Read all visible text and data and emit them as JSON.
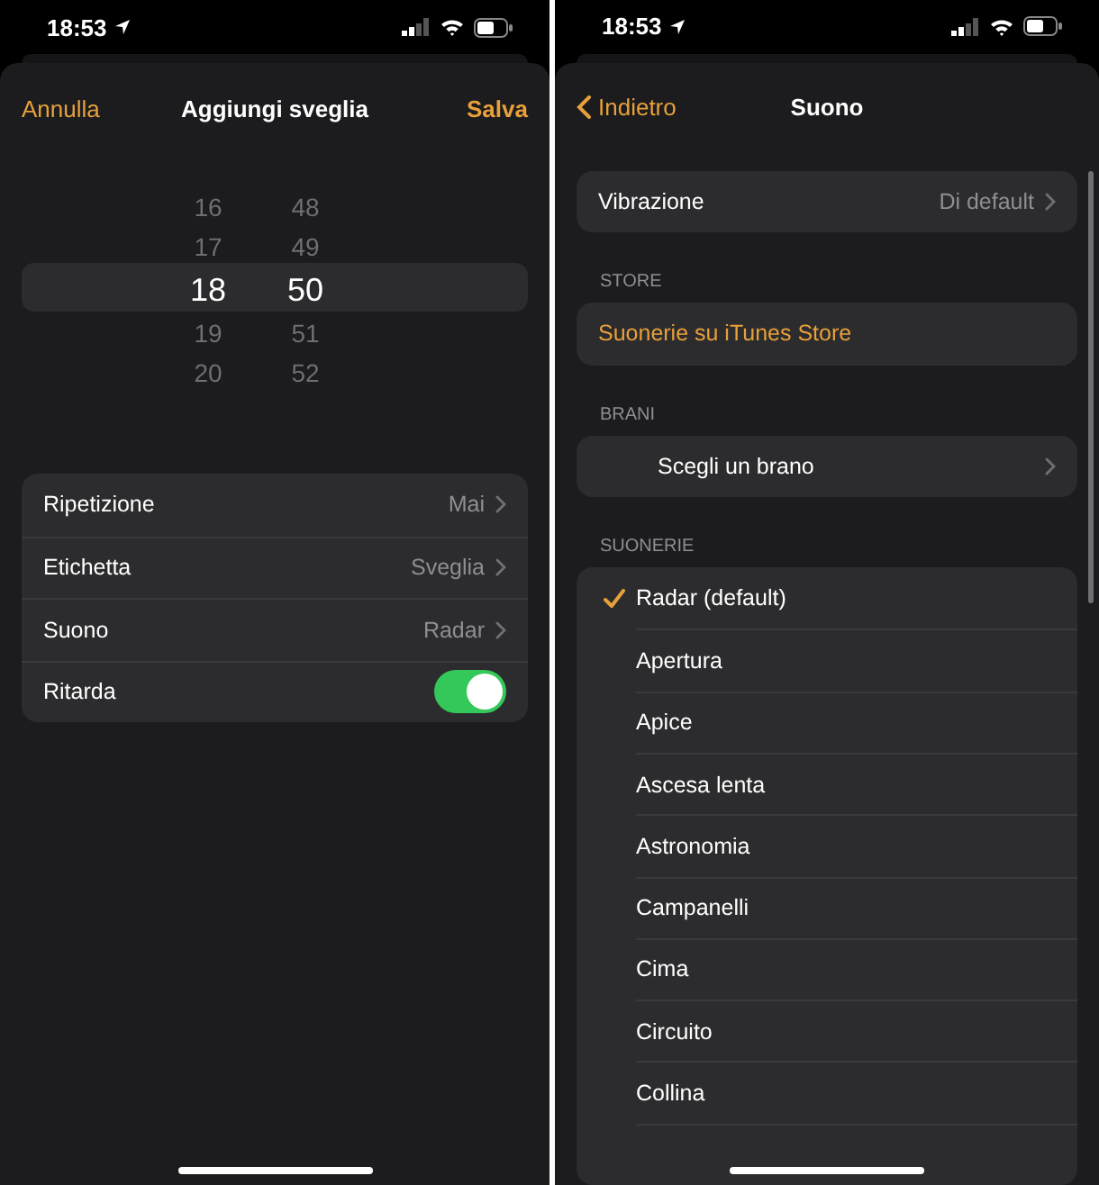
{
  "left_screen": {
    "status_bar": {
      "time": "18:53"
    },
    "nav": {
      "cancel": "Annulla",
      "title": "Aggiungi sveglia",
      "save": "Salva"
    },
    "picker": {
      "hours": [
        {
          "value": "16",
          "selected": false
        },
        {
          "value": "17",
          "selected": false
        },
        {
          "value": "18",
          "selected": true
        },
        {
          "value": "19",
          "selected": false
        },
        {
          "value": "20",
          "selected": false
        }
      ],
      "minutes": [
        {
          "value": "48",
          "selected": false
        },
        {
          "value": "49",
          "selected": false
        },
        {
          "value": "50",
          "selected": true
        },
        {
          "value": "51",
          "selected": false
        },
        {
          "value": "52",
          "selected": false
        }
      ]
    },
    "settings": [
      {
        "kind": "link",
        "label": "Ripetizione",
        "value": "Mai"
      },
      {
        "kind": "link",
        "label": "Etichetta",
        "value": "Sveglia"
      },
      {
        "kind": "link",
        "label": "Suono",
        "value": "Radar"
      },
      {
        "kind": "toggle",
        "label": "Ritarda",
        "on": true
      }
    ]
  },
  "right_screen": {
    "status_bar": {
      "time": "18:53"
    },
    "nav": {
      "back": "Indietro",
      "title": "Suono"
    },
    "vibration": {
      "label": "Vibrazione",
      "value": "Di default"
    },
    "sections": [
      {
        "header": "STORE",
        "kind": "store",
        "items": [
          {
            "label": "Suonerie su iTunes Store"
          }
        ]
      },
      {
        "header": "BRANI",
        "kind": "songs",
        "items": [
          {
            "label": "Scegli un brano"
          }
        ]
      },
      {
        "header": "SUONERIE",
        "kind": "ringtones",
        "items": [
          {
            "label": "Radar (default)",
            "selected": true
          },
          {
            "label": "Apertura",
            "selected": false
          },
          {
            "label": "Apice",
            "selected": false
          },
          {
            "label": "Ascesa lenta",
            "selected": false
          },
          {
            "label": "Astronomia",
            "selected": false
          },
          {
            "label": "Campanelli",
            "selected": false
          },
          {
            "label": "Cima",
            "selected": false
          },
          {
            "label": "Circuito",
            "selected": false
          },
          {
            "label": "Collina",
            "selected": false
          }
        ]
      }
    ]
  }
}
